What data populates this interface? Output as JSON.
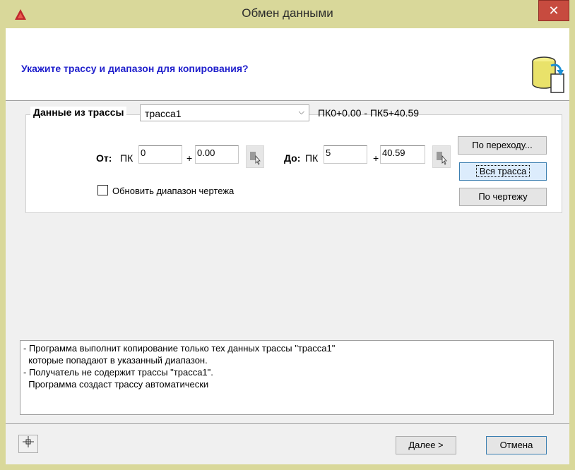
{
  "window": {
    "title": "Обмен данными",
    "close_glyph": "✕"
  },
  "header": {
    "prompt": "Укажите трассу и диапазон для копирования?"
  },
  "group": {
    "title": "Данные из трассы",
    "route_select": {
      "value": "трасса1",
      "arrow": "⌵"
    },
    "range_text": "ПК0+0.00 - ПК5+40.59"
  },
  "from": {
    "label": "От:",
    "pk_label": "ПК",
    "pk_value": "0",
    "plus": "+",
    "offset_value": "0.00"
  },
  "to": {
    "label": "До:",
    "pk_label": "ПК",
    "pk_value": "5",
    "plus": "+",
    "offset_value": "40.59"
  },
  "buttons": {
    "by_transition": "По переходу...",
    "whole_route": "Вся трасса",
    "by_drawing": "По чертежу",
    "next": "Далее >",
    "cancel": "Отмена"
  },
  "checkbox": {
    "label": "Обновить диапазон чертежа",
    "checked": false
  },
  "info_text": "- Программа выполнит копирование только тех данных трассы \"трасса1\"\n  которые попадают в указанный диапазон.\n- Получатель не содержит трассы \"трасса1\".\n  Программа создаст трассу автоматически",
  "icons": {
    "app": "autocad-logo-icon",
    "database": "database-export-icon",
    "pick": "pick-point-icon",
    "footer": "crosshair-icon"
  },
  "colors": {
    "title_bar": "#d9d89a",
    "close_button": "#c74b3f",
    "prompt_text": "#1f1fcc"
  }
}
